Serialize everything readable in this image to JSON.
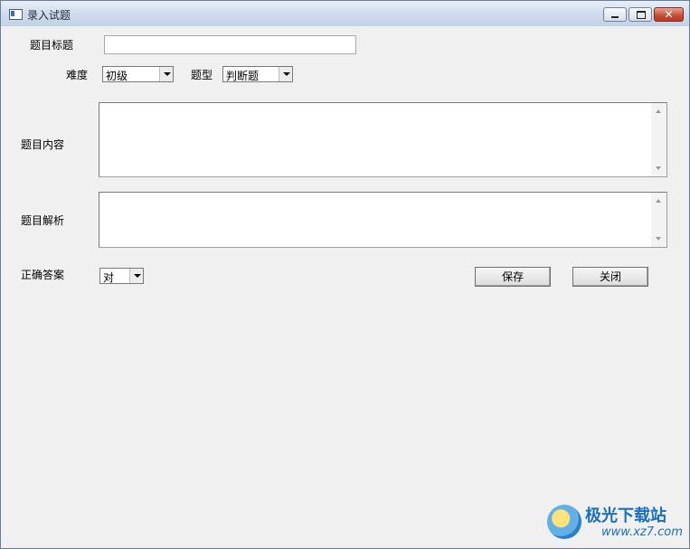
{
  "window": {
    "title": "录入试题",
    "controls": {
      "minimize_icon": "minimize-icon",
      "maximize_icon": "maximize-icon",
      "close_icon": "close-icon",
      "close_glyph": "✕"
    }
  },
  "form": {
    "title_label": "题目标题",
    "title_value": "",
    "difficulty_label": "难度",
    "difficulty_value": "初级",
    "type_label": "题型",
    "type_value": "判断题",
    "content_label": "题目内容",
    "content_value": "",
    "analysis_label": "题目解析",
    "analysis_value": "",
    "answer_label": "正确答案",
    "answer_value": "对"
  },
  "buttons": {
    "save": "保存",
    "close": "关闭"
  },
  "watermark": {
    "brand": "极光下载站",
    "url": "www.xz7.com"
  }
}
